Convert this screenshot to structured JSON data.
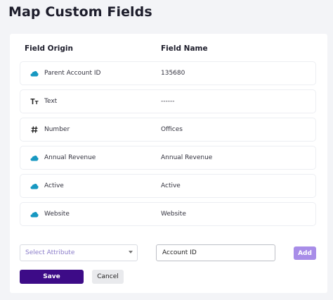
{
  "page": {
    "title": "Map Custom Fields"
  },
  "table": {
    "headers": {
      "origin": "Field Origin",
      "name": "Field Name"
    },
    "rows": [
      {
        "icon": "salesforce-cloud-icon",
        "origin": "Parent Account ID",
        "name": "135680"
      },
      {
        "icon": "text-type-icon",
        "origin": "Text",
        "name": "------"
      },
      {
        "icon": "hash-number-icon",
        "origin": "Number",
        "name": "Offices"
      },
      {
        "icon": "salesforce-cloud-icon",
        "origin": "Annual Revenue",
        "name": "Annual Revenue"
      },
      {
        "icon": "salesforce-cloud-icon",
        "origin": "Active",
        "name": "Active"
      },
      {
        "icon": "salesforce-cloud-icon",
        "origin": "Website",
        "name": "Website"
      }
    ]
  },
  "add_form": {
    "select_placeholder": "Select Attribute",
    "input_value": "Account ID",
    "add_label": "Add"
  },
  "actions": {
    "save_label": "Save",
    "cancel_label": "Cancel"
  },
  "colors": {
    "primary": "#3d0b87",
    "add_button": "#a88de8",
    "salesforce_blue": "#1798c1",
    "placeholder": "#8a7cc9"
  }
}
